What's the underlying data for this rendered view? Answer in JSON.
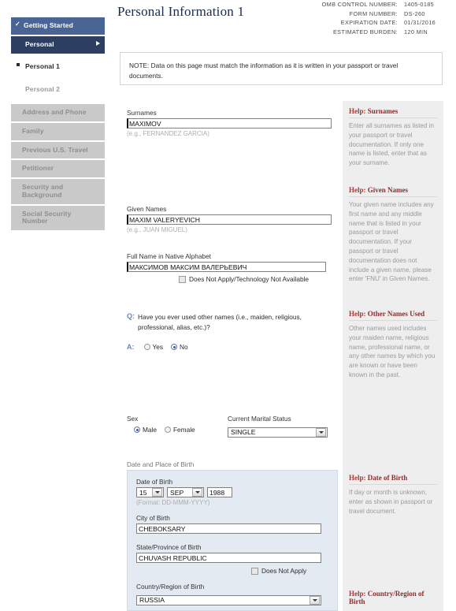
{
  "sidebar": {
    "items": [
      {
        "label": "Getting Started",
        "state": "done",
        "icon": "check-icon"
      },
      {
        "label": "Personal",
        "state": "current-group",
        "icon": "arrow-right-icon"
      },
      {
        "label": "Personal 1",
        "state": "sub-active",
        "icon": "bullet-icon"
      },
      {
        "label": "Personal 2",
        "state": "sub"
      },
      {
        "label": "Address and Phone",
        "state": "disabled"
      },
      {
        "label": "Family",
        "state": "disabled"
      },
      {
        "label": "Previous U.S. Travel",
        "state": "disabled"
      },
      {
        "label": "Petitioner",
        "state": "disabled"
      },
      {
        "label": "Security and Background",
        "state": "disabled"
      },
      {
        "label": "Social Security Number",
        "state": "disabled"
      }
    ]
  },
  "header": {
    "title": "Personal Information 1",
    "meta": [
      {
        "label": "OMB CONTROL NUMBER:",
        "value": "1405-0185"
      },
      {
        "label": "FORM NUMBER:",
        "value": "DS-260"
      },
      {
        "label": "EXPIRATION DATE:",
        "value": "01/31/2016"
      },
      {
        "label": "ESTIMATED BURDEN:",
        "value": "120 MIN"
      }
    ]
  },
  "note": {
    "text": "NOTE: Data on this page must match the information as it is written in your passport or travel documents."
  },
  "form": {
    "surnames": {
      "label": "Surnames",
      "value": "MAXIMOV",
      "hint": "(e.g., FERNANDEZ GARCIA)"
    },
    "given_names": {
      "label": "Given Names",
      "value": "MAXIM VALERYEVICH",
      "hint": "(e.g., JUAN MIGUEL)"
    },
    "native_alphabet": {
      "label": "Full Name in Native Alphabet",
      "value": "МАКСИМОВ МАКСИМ ВАЛЕРЬЕВИЧ",
      "checkbox_label": "Does Not Apply/Technology Not Available",
      "checked": false
    },
    "other_names": {
      "q_marker": "Q:",
      "a_marker": "A:",
      "question": "Have you ever used other names (i.e., maiden, religious, professional, alias, etc.)?",
      "option_yes": "Yes",
      "option_no": "No",
      "selected": "No"
    },
    "sex": {
      "label": "Sex",
      "option_male": "Male",
      "option_female": "Female",
      "selected": "Male"
    },
    "marital_status": {
      "label": "Current Marital Status",
      "value": "SINGLE"
    },
    "birth_group_label": "Date and Place of Birth",
    "date_of_birth": {
      "label": "Date of Birth",
      "day": "15",
      "month": "SEP",
      "year": "1988",
      "hint": "(Format: DD-MMM-YYYY)"
    },
    "city_of_birth": {
      "label": "City of Birth",
      "value": "CHEBOKSARY"
    },
    "state_of_birth": {
      "label": "State/Province of Birth",
      "value": "CHUVASH REPUBLIC",
      "checkbox_label": "Does Not Apply",
      "checked": false
    },
    "country_of_birth": {
      "label": "Country/Region of Birth",
      "value": "RUSSIA"
    }
  },
  "help": {
    "surnames": {
      "title_prefix": "Help:",
      "title": " Surnames",
      "body": "Enter all surnames as listed in your passport or travel documentation. If only one name is listed, enter that as your surname."
    },
    "given_names": {
      "title_prefix": "Help:",
      "title": " Given Names",
      "body": "Your given name includes any first name and any middle name that is listed in your passport or travel documentation. If your passport or travel documentation does not include a given name, please enter 'FNU' in Given Names."
    },
    "other_names": {
      "title_prefix": "Help:",
      "title": " Other Names Used",
      "body": "Other names used includes your maiden name, religious name, professional name, or any other names by which you are known or have been known in the past."
    },
    "date_of_birth": {
      "title_prefix": "Help:",
      "title": " Date of Birth",
      "body": "If day or month is unknown, enter as shown in passport or travel document."
    },
    "country_of_birth": {
      "title_prefix": "Help:",
      "title": " Country/Region of Birth",
      "body": ""
    }
  },
  "colors": {
    "nav_done": "#4a6595",
    "nav_current": "#2c3e62",
    "nav_disabled": "#c9c9c9",
    "help_title": "#8a2f2f",
    "panel_blue": "#e4eaf2"
  }
}
